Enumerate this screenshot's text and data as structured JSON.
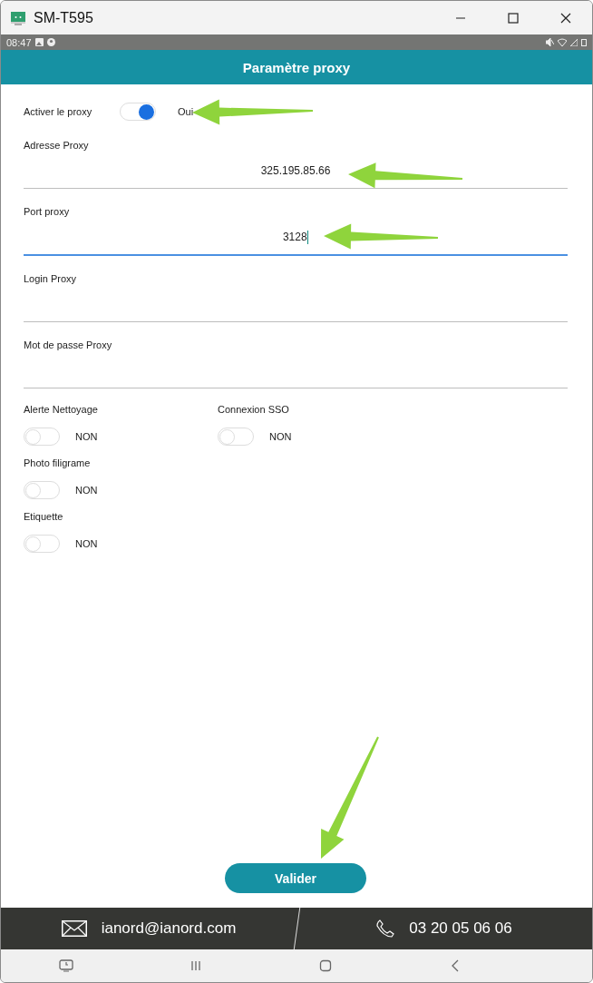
{
  "window": {
    "title": "SM-T595"
  },
  "status_bar": {
    "time": "08:47"
  },
  "header": {
    "title": "Paramètre proxy"
  },
  "proxy_toggle": {
    "label": "Activer le proxy",
    "on": true,
    "state_text": "Oui"
  },
  "fields": [
    {
      "label": "Adresse Proxy",
      "value": "325.195.85.66",
      "focused": false
    },
    {
      "label": "Port proxy",
      "value": "3128",
      "focused": true
    },
    {
      "label": "Login Proxy",
      "focused": false
    },
    {
      "label": "Mot de passe Proxy",
      "focused": false
    }
  ],
  "toggle_rows": [
    {
      "toggles": [
        {
          "label": "Alerte Nettoyage",
          "on": false,
          "state_text": "NON"
        },
        {
          "label": "Connexion SSO",
          "on": false,
          "state_text": "NON"
        }
      ]
    },
    {
      "toggles": [
        {
          "label": "Photo filigrame",
          "on": false,
          "state_text": "NON"
        }
      ]
    },
    {
      "toggles": [
        {
          "label": "Etiquette",
          "on": false,
          "state_text": "NON"
        }
      ]
    }
  ],
  "submit_button": {
    "label": "Valider"
  },
  "footer": {
    "email": "ianord@ianord.com",
    "phone": "03 20 05 06 06"
  }
}
